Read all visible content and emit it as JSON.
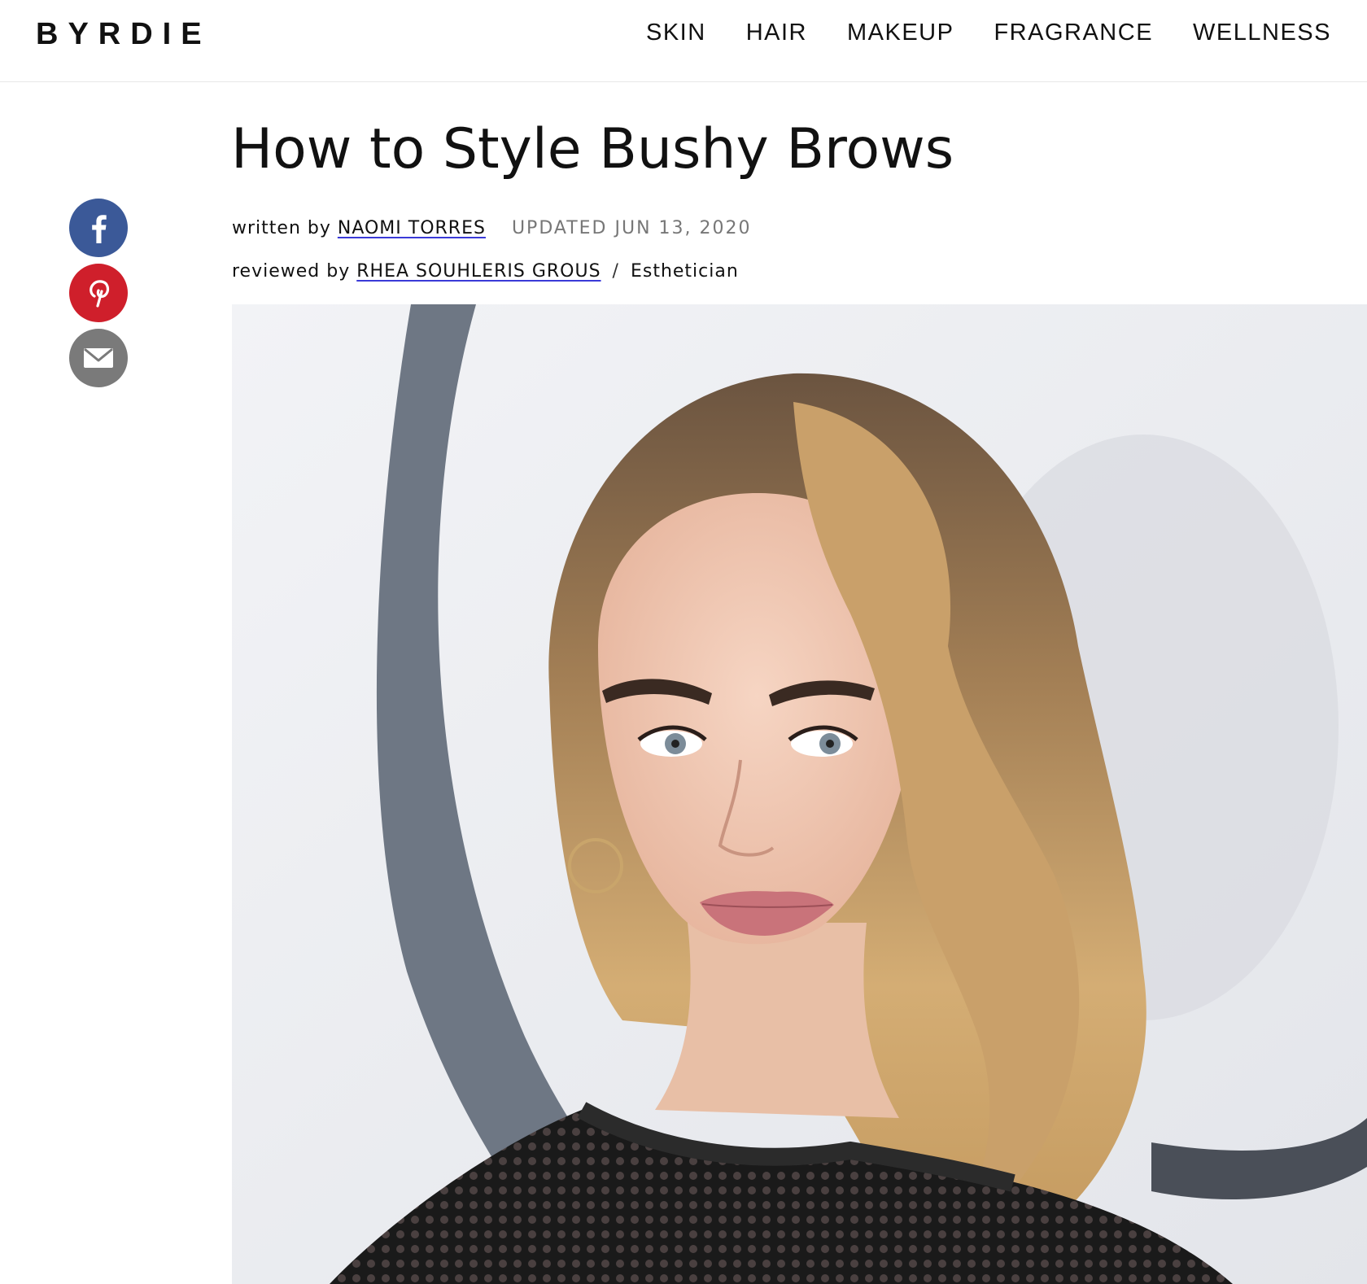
{
  "header": {
    "logo": "BYRDIE",
    "nav": [
      "SKIN",
      "HAIR",
      "MAKEUP",
      "FRAGRANCE",
      "WELLNESS"
    ]
  },
  "share": {
    "icons": [
      "facebook-icon",
      "pinterest-icon",
      "mail-icon"
    ],
    "colors": {
      "facebook": "#3b5998",
      "pinterest": "#cf1f2b",
      "mail": "#7a7a7a"
    }
  },
  "article": {
    "title": "How to Style Bushy Brows",
    "written_by_label": "written by",
    "author": "NAOMI TORRES",
    "updated": "UPDATED JUN 13, 2020",
    "reviewed_by_label": "reviewed by",
    "reviewer": "RHEA SOUHLERIS GROUS",
    "separator": "/",
    "reviewer_role": "Esthetician"
  },
  "hero_image": {
    "subject": "portrait photo of a woman with bushy brows and wavy blonde hair"
  }
}
